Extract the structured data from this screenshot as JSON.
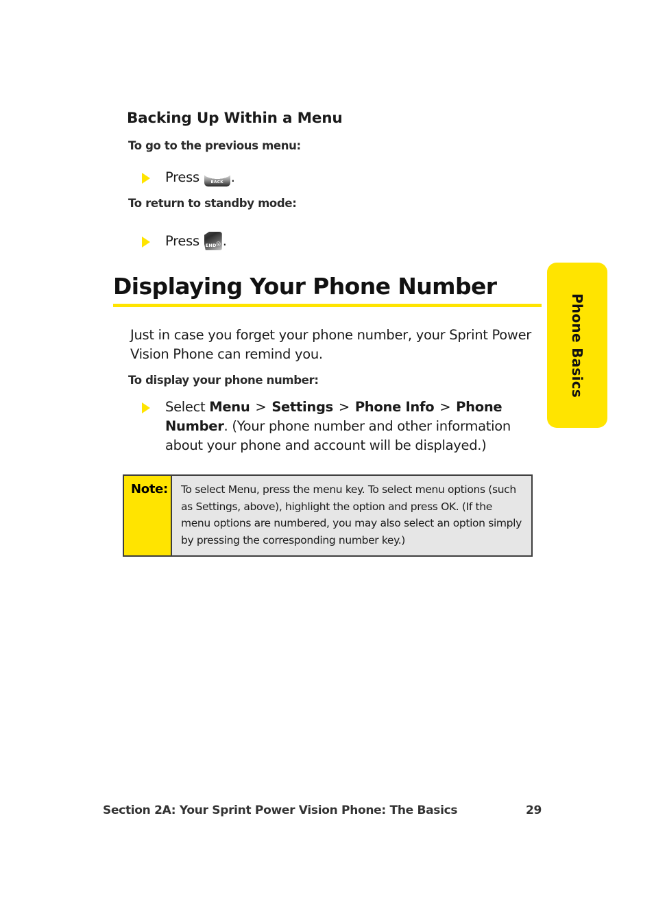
{
  "document": {
    "section_heading": "Backing Up Within a Menu",
    "main_heading": "Displaying Your Phone Number"
  },
  "back_menu": {
    "sub_previous": "To go to the previous menu:",
    "press_label": "Press",
    "back_key_cap": "BACK",
    "period": ".",
    "sub_standby": "To return to standby mode:",
    "end_key_cap": "END",
    "end_key_sup": "ⓤ"
  },
  "phone_number": {
    "intro": "Just in case you forget your phone number, your Sprint Power Vision Phone can remind you.",
    "sub_display": "To display your phone number:",
    "step": {
      "lead": "Select ",
      "menu": "Menu",
      "sep1": " > ",
      "settings": "Settings",
      "sep2": " > ",
      "phone_info": "Phone Info",
      "sep3": " > ",
      "phone_number": "Phone Number",
      "trail": ".",
      "detail": "(Your phone number and other information about your phone and account will be displayed.)"
    }
  },
  "note": {
    "label": "Note:",
    "body": "To select Menu, press the menu key. To select menu options (such as Settings, above), highlight the option and press OK. (If the menu options are numbered, you may also select an option simply by pressing the corresponding number key.)"
  },
  "side_tab": {
    "label": "Phone Basics"
  },
  "footer": {
    "section": "Section 2A: Your Sprint Power Vision Phone: The Basics",
    "page_number": "29"
  },
  "colors": {
    "accent_yellow": "#ffe400",
    "note_body_gray": "#e6e6e6",
    "note_border": "#3d3d3d",
    "text_black": "#111111"
  }
}
